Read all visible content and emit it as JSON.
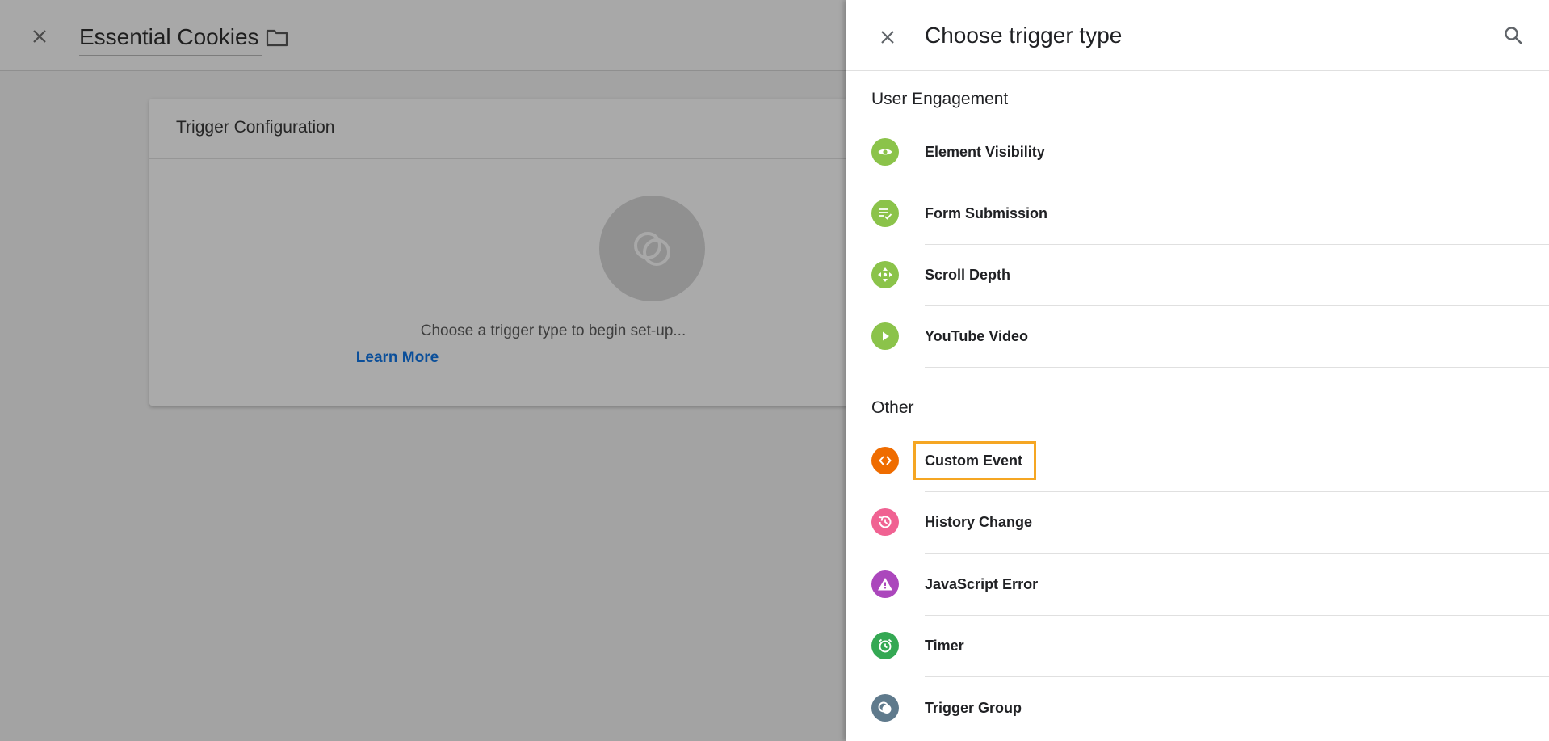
{
  "editor": {
    "title": "Essential Cookies",
    "card_title": "Trigger Configuration",
    "hint": "Choose a trigger type to begin set-up...",
    "learn_more": "Learn More"
  },
  "panel": {
    "title": "Choose trigger type",
    "sections": [
      {
        "title": "User Engagement",
        "items": [
          {
            "label": "Element Visibility",
            "icon": "eye-icon",
            "color": "#8bc34a"
          },
          {
            "label": "Form Submission",
            "icon": "form-check-icon",
            "color": "#8bc34a"
          },
          {
            "label": "Scroll Depth",
            "icon": "scroll-arrows-icon",
            "color": "#8bc34a"
          },
          {
            "label": "YouTube Video",
            "icon": "play-icon",
            "color": "#8bc34a"
          }
        ]
      },
      {
        "title": "Other",
        "items": [
          {
            "label": "Custom Event",
            "icon": "code-brackets-icon",
            "color": "#ef6c00"
          },
          {
            "label": "History Change",
            "icon": "history-icon",
            "color": "#f06292"
          },
          {
            "label": "JavaScript Error",
            "icon": "warning-icon",
            "color": "#ab47bc"
          },
          {
            "label": "Timer",
            "icon": "alarm-icon",
            "color": "#34a853"
          },
          {
            "label": "Trigger Group",
            "icon": "trigger-group-icon",
            "color": "#5f7a8c"
          }
        ]
      }
    ]
  },
  "highlighted_item": "Custom Event"
}
